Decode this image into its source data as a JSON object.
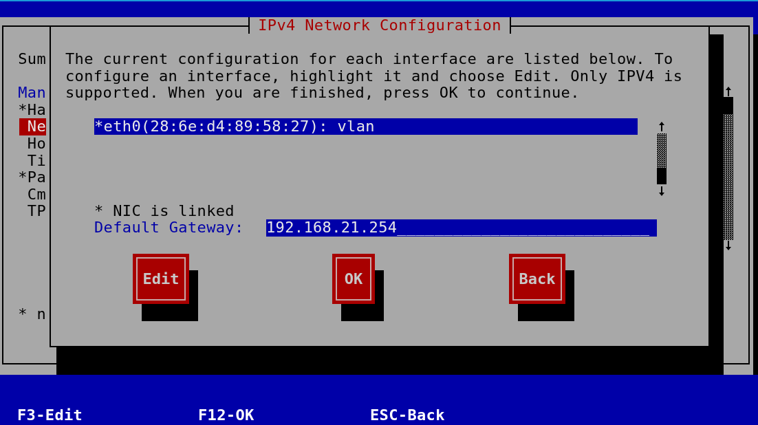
{
  "background_window": {
    "sidebar": [
      {
        "label": "Sum",
        "kind": "heading",
        "selected": false
      },
      {
        "label": "Man",
        "kind": "section",
        "selected": false
      },
      {
        "label": "*Ha",
        "kind": "item",
        "selected": false
      },
      {
        "label": "Ne",
        "kind": "item",
        "selected": true
      },
      {
        "label": "Ho",
        "kind": "item",
        "selected": false
      },
      {
        "label": "Ti",
        "kind": "item",
        "selected": false
      },
      {
        "label": "*Pa",
        "kind": "item",
        "selected": false
      },
      {
        "label": "Cm",
        "kind": "item",
        "selected": false
      },
      {
        "label": "TP",
        "kind": "item",
        "selected": false
      }
    ],
    "footnote": "* n"
  },
  "dialog": {
    "title": "IPv4 Network Configuration",
    "message": "The current configuration for each interface are listed below. To configure an interface, highlight it and choose Edit. Only IPV4 is supported. When you are finished, press OK to continue.",
    "interfaces": [
      {
        "label": "*eth0(28:6e:d4:89:58:27): vlan",
        "selected": true
      }
    ],
    "legend": "* NIC is linked",
    "gateway": {
      "label": "Default Gateway:",
      "value": "192.168.21.254___________________________"
    },
    "buttons": [
      {
        "label": "Edit"
      },
      {
        "label": "OK"
      },
      {
        "label": "Back"
      }
    ]
  },
  "hotkeys": [
    "F3-Edit",
    "F12-OK",
    "ESC-Back"
  ]
}
